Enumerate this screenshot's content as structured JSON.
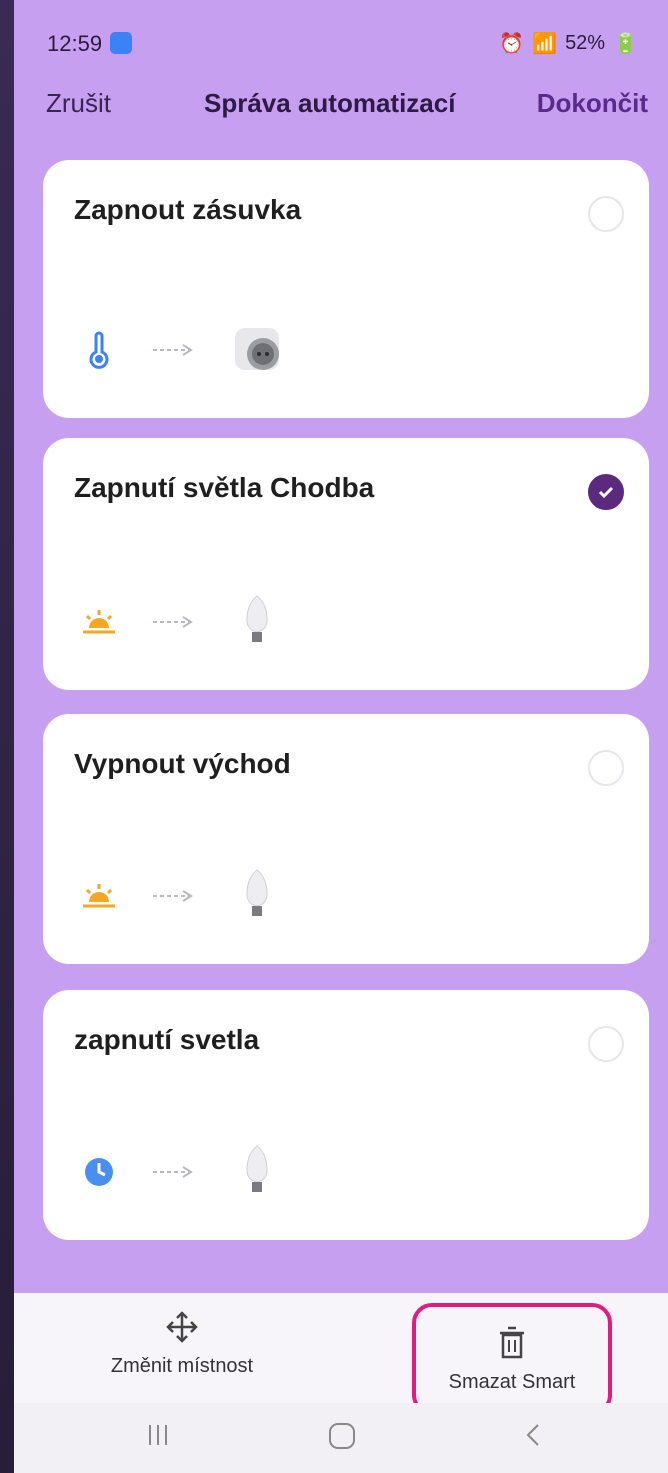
{
  "status": {
    "time": "12:59",
    "battery": "52%"
  },
  "header": {
    "cancel": "Zrušit",
    "title": "Správa automatizací",
    "done": "Dokončit"
  },
  "automations": [
    {
      "name": "Zapnout zásuvka",
      "trigger_icon": "thermometer-icon",
      "device_icon": "smart-plug-icon",
      "selected": false
    },
    {
      "name": "Zapnutí světla Chodba",
      "trigger_icon": "sunrise-icon",
      "device_icon": "light-bulb-icon",
      "selected": true
    },
    {
      "name": "Vypnout východ",
      "trigger_icon": "sunrise-icon",
      "device_icon": "light-bulb-icon",
      "selected": false
    },
    {
      "name": "zapnutí svetla",
      "trigger_icon": "clock-icon",
      "device_icon": "light-bulb-icon",
      "selected": false
    }
  ],
  "bottom_bar": {
    "move_label": "Změnit místnost",
    "delete_label": "Smazat Smart"
  },
  "colors": {
    "background": "#c79ff0",
    "accent": "#5b2a7f",
    "highlight": "#e11b7f"
  }
}
